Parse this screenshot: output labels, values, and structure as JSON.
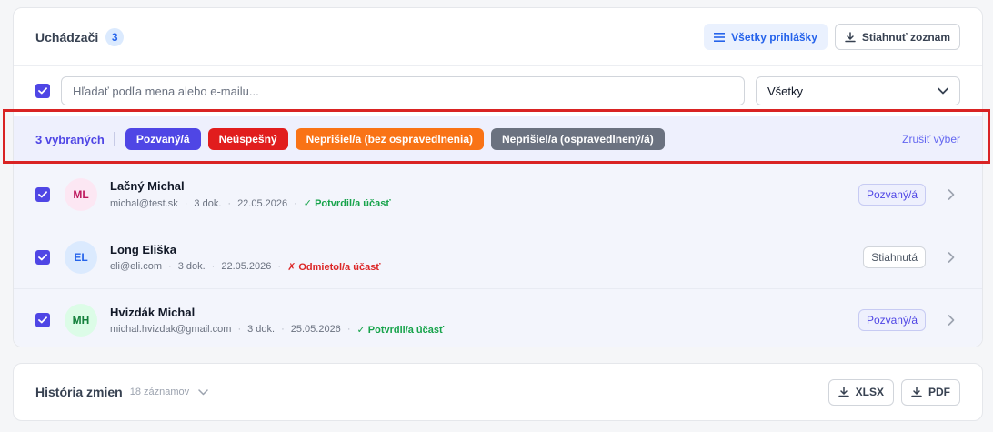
{
  "applicants": {
    "title": "Uchádzači",
    "count": "3",
    "all_applications_label": "Všetky prihlášky",
    "download_list_label": "Stiahnuť zoznam",
    "search_placeholder": "Hľadať podľa mena alebo e-mailu...",
    "filter_selected": "Všetky"
  },
  "selection": {
    "count_label": "3 vybraných",
    "chips": [
      {
        "label": "Pozvaný/á",
        "color": "#4f46e5"
      },
      {
        "label": "Neúspešný",
        "color": "#e11d1d"
      },
      {
        "label": "Neprišiel/a (bez ospravedlnenia)",
        "color": "#f97316"
      },
      {
        "label": "Neprišiel/a (ospravedlnený/á)",
        "color": "#6b7280"
      }
    ],
    "clear_label": "Zrušiť výber"
  },
  "rows": [
    {
      "initials": "ML",
      "name": "Lačný Michal",
      "email": "michal@test.sk",
      "docs": "3 dok.",
      "date": "22.05.2026",
      "attendance": "✓ Potvrdil/a účasť",
      "status": "Pozvaný/á",
      "avatar_bg": "#fce7f3",
      "avatar_fg": "#be185d"
    },
    {
      "initials": "EL",
      "name": "Long Eliška",
      "email": "eli@eli.com",
      "docs": "3 dok.",
      "date": "22.05.2026",
      "attendance": "✗ Odmietol/a účasť",
      "status": "Stiahnutá",
      "avatar_bg": "#dbeafe",
      "avatar_fg": "#2563eb"
    },
    {
      "initials": "MH",
      "name": "Hvizdák Michal",
      "email": "michal.hvizdak@gmail.com",
      "docs": "3 dok.",
      "date": "25.05.2026",
      "attendance": "✓ Potvrdil/a účasť",
      "status": "Pozvaný/á",
      "avatar_bg": "#dcfce7",
      "avatar_fg": "#15803d"
    }
  ],
  "history": {
    "title": "História zmien",
    "count": "18 záznamov",
    "xlsx_label": "XLSX",
    "pdf_label": "PDF"
  }
}
